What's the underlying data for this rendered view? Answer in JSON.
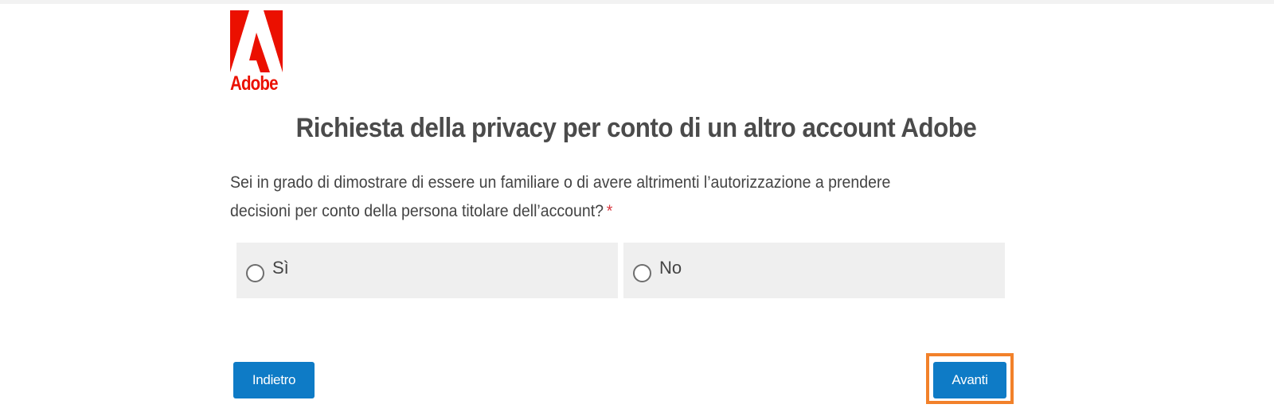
{
  "brand": {
    "logo_text": "Adobe",
    "color": "#eb1000"
  },
  "page": {
    "title": "Richiesta della privacy per conto di un altro account Adobe",
    "question": "Sei in grado di dimostrare di essere un familiare o di avere altrimenti l’autorizzazione a prendere decisioni per conto della persona titolare dell’account?",
    "required_mark": "*"
  },
  "options": [
    {
      "label": "Sì",
      "selected": false
    },
    {
      "label": "No",
      "selected": false
    }
  ],
  "buttons": {
    "back_label": "Indietro",
    "next_label": "Avanti"
  },
  "colors": {
    "button_blue": "#0e7bc6",
    "highlight_orange": "#f2812a",
    "option_bg": "#efefef",
    "required_red": "#d7373f"
  }
}
